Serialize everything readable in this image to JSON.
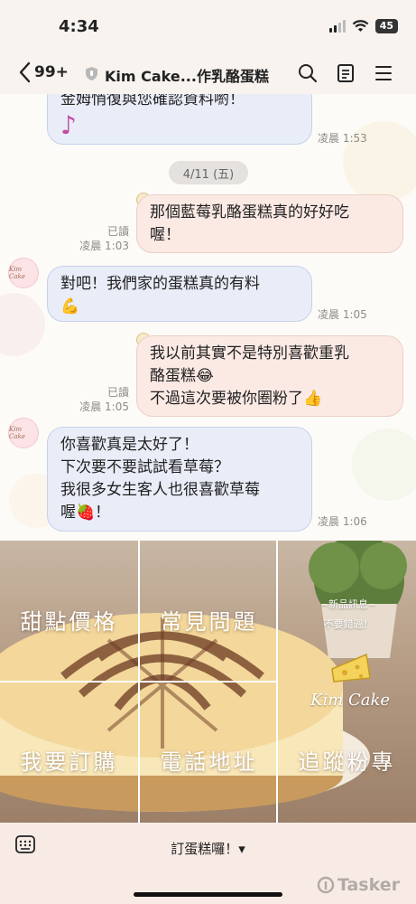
{
  "status_bar": {
    "time": "4:34",
    "battery": "45"
  },
  "header": {
    "back_count": "99+",
    "title": "Kim Cake...作乳酪蛋糕"
  },
  "chat": {
    "partial_message": "金姆悄復與您確認資料喲！",
    "partial_time": "凌晨 1:53",
    "date_chip": "4/11 (五)",
    "messages": [
      {
        "side": "out",
        "lines": [
          "那個藍莓乳酪蛋糕真的好好吃",
          "喔！"
        ],
        "read": "已讀",
        "time": "凌晨 1:03"
      },
      {
        "side": "in",
        "lines": [
          "對吧！我們家的蛋糕真的有料",
          "💪"
        ],
        "time": "凌晨 1:05"
      },
      {
        "side": "out",
        "lines": [
          "我以前其實不是特別喜歡重乳",
          "酪蛋糕😂",
          "不過這次要被你圈粉了👍"
        ],
        "read": "已讀",
        "time": "凌晨 1:05"
      },
      {
        "side": "in",
        "lines": [
          "你喜歡真是太好了！",
          "下次要不要試試看草莓？",
          "我很多女生客人也很喜歡草莓",
          "喔🍓！"
        ],
        "time": "凌晨 1:06"
      }
    ],
    "avatar_text": "Kim Cake"
  },
  "rich_menu": {
    "items": [
      "甜點價格",
      "常見問題",
      "我要訂購",
      "電話地址",
      "追蹤粉專"
    ],
    "promo_line1": "~新品訊息~",
    "promo_line2": "不要錯過！",
    "brand": "Kim Cake"
  },
  "bottom_bar": {
    "menu_label": "訂蛋糕囉！▾"
  },
  "watermark": "Tasker"
}
